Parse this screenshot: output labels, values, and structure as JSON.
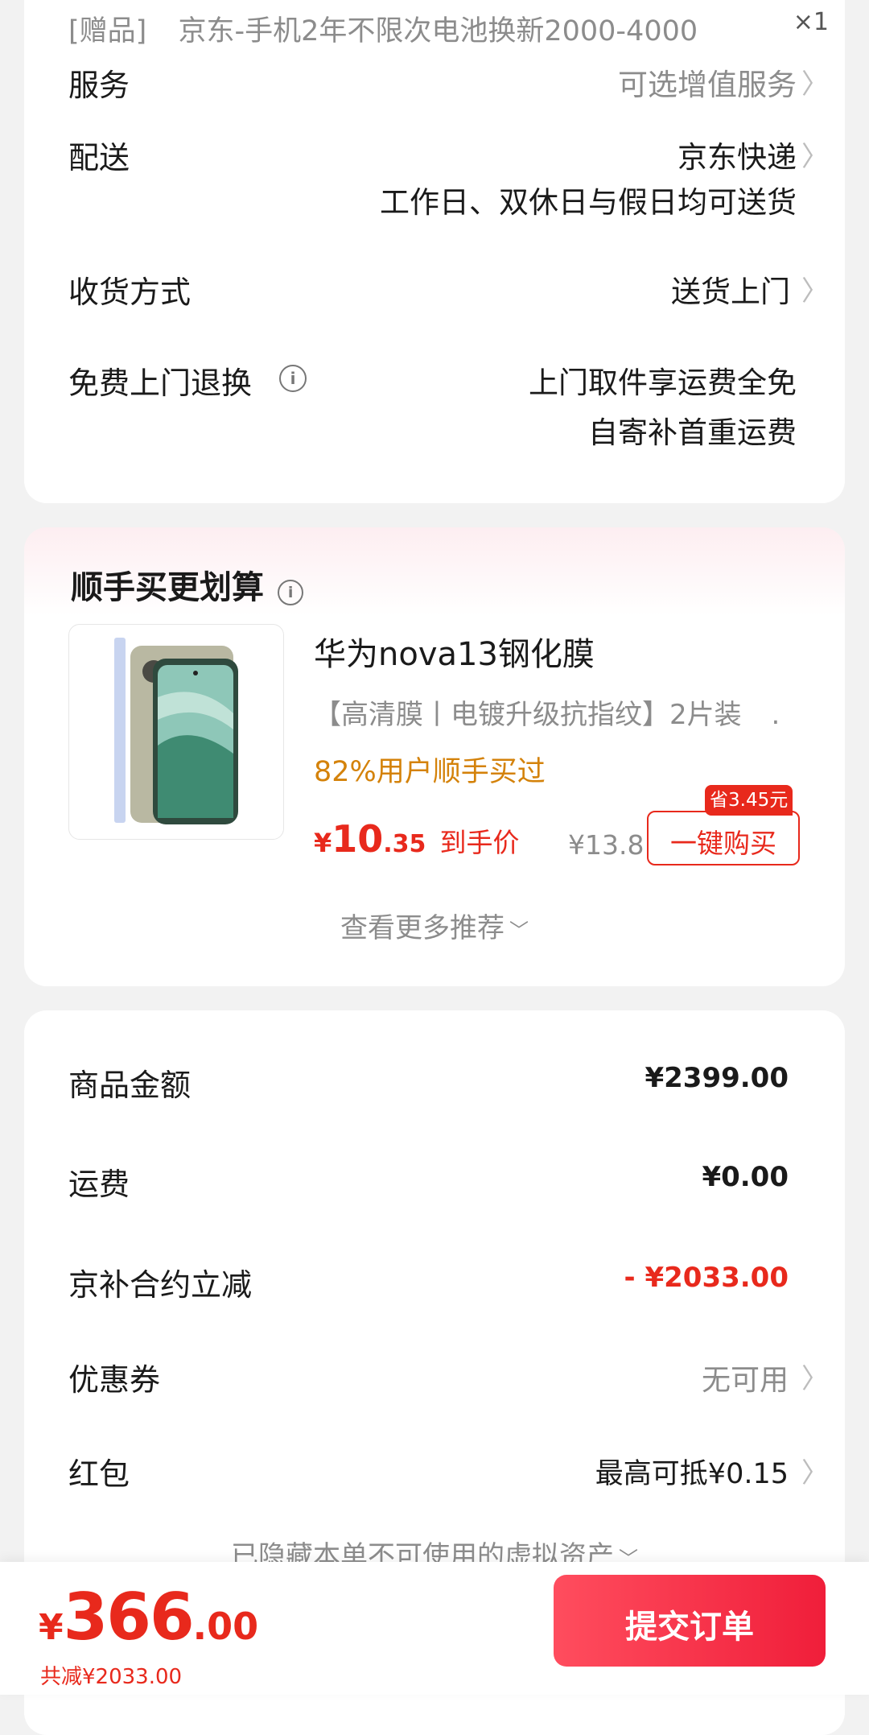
{
  "gift_row": {
    "tag": "[赠品]",
    "text": "京东-手机2年不限次电池换新2000-4000",
    "qty": "×1"
  },
  "service_rows": {
    "service": {
      "label": "服务",
      "value": "可选增值服务"
    },
    "delivery": {
      "label": "配送",
      "value": "京东快递",
      "sub": "工作日、双休日与假日均可送货"
    },
    "receive": {
      "label": "收货方式",
      "value": "送货上门"
    },
    "free_return": {
      "label": "免费上门退换",
      "line1": "上门取件享运费全免",
      "line2": "自寄补首重运费"
    }
  },
  "bundle": {
    "title": "顺手买更划算",
    "product": {
      "name": "华为nova13钢化膜",
      "desc": "【高清膜丨电镀升级抗指纹】2片装",
      "desc_tail": ".",
      "bought": "82%用户顺手买过",
      "price_symbol": "¥",
      "price_int": "10",
      "price_dec": ".35",
      "price_suffix": "到手价",
      "original_price": "¥13.8",
      "save_badge": "省3.45元",
      "buy_button": "一键购买"
    },
    "more": "查看更多推荐"
  },
  "summary": {
    "goods": {
      "label": "商品金额",
      "value": "¥2399.00"
    },
    "shipping": {
      "label": "运费",
      "value": "¥0.00"
    },
    "subsidy": {
      "label": "京补合约立减",
      "value": "- ¥2033.00"
    },
    "coupon": {
      "label": "优惠券",
      "value": "无可用"
    },
    "redpack": {
      "label": "红包",
      "value": "最高可抵¥0.15"
    },
    "hidden_assets": "已隐藏本单不可使用的虚拟资产"
  },
  "footer": {
    "price_symbol": "¥",
    "price_int": "366",
    "price_dec": ".00",
    "total_discount": "共减¥2033.00",
    "submit": "提交订单"
  },
  "colors": {
    "accent_red": "#e8291c",
    "orange": "#d4820a",
    "submit_gradient": [
      "#ff4d5e",
      "#f01e3a"
    ]
  }
}
